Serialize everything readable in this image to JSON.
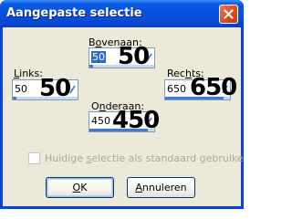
{
  "window": {
    "title": "Aangepaste selectie"
  },
  "fields": {
    "top": {
      "label_pre": "B",
      "label_key": "o",
      "label_post": "venaan:",
      "value": "50",
      "overlay": "50",
      "bar_fraction": 0.06
    },
    "left": {
      "label_pre": "",
      "label_key": "L",
      "label_post": "inks:",
      "value": "50",
      "overlay": "50",
      "bar_fraction": 0.06
    },
    "right": {
      "label_pre": "Rec",
      "label_key": "h",
      "label_post": "ts:",
      "value": "650",
      "overlay": "650",
      "bar_fraction": 0.9
    },
    "bottom": {
      "label_pre": "O",
      "label_key": "n",
      "label_post": "deraan:",
      "value": "450",
      "overlay": "450",
      "bar_fraction": 0.9
    }
  },
  "checkbox": {
    "label_pre": "Huidige ",
    "label_key": "s",
    "label_post": "electie als standaard gebruiken",
    "checked": false,
    "enabled": false
  },
  "buttons": {
    "ok": {
      "label_key": "O",
      "label_post": "K"
    },
    "cancel": {
      "label_key": "A",
      "label_post": "nnuleren"
    }
  },
  "colors": {
    "title_bar": "#0550de",
    "dialog_bg": "#ece9d8",
    "close_button": "#d44a1e",
    "selection": "#316ac5",
    "spin_bar": "#3d7bd8"
  },
  "icons": {
    "close": "close-x-icon",
    "spin": "spin-arrow-icon"
  }
}
